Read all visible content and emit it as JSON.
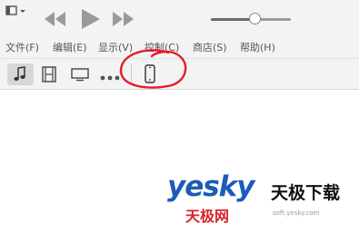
{
  "menu": {
    "items": [
      "文件(F)",
      "编辑(E)",
      "显示(V)",
      "控制(C)",
      "商店(S)",
      "帮助(H)"
    ]
  },
  "volume": {
    "level": 0.55
  },
  "icons": {
    "window_menu": "window-menu-icon",
    "previous": "previous-track-icon",
    "play": "play-icon",
    "next": "next-track-icon",
    "music": "music-note-icon",
    "movies": "film-icon",
    "tv": "tv-icon",
    "more": "more-icon",
    "device": "iphone-icon"
  },
  "watermark": {
    "logo": "yesky",
    "cn_name": "天极下载",
    "cn_sub": "天极网",
    "url": "soft.yesky.com"
  },
  "colors": {
    "annotation": "#e8192c",
    "brand_blue": "#1c5bb8",
    "brand_red": "#d8232a"
  }
}
